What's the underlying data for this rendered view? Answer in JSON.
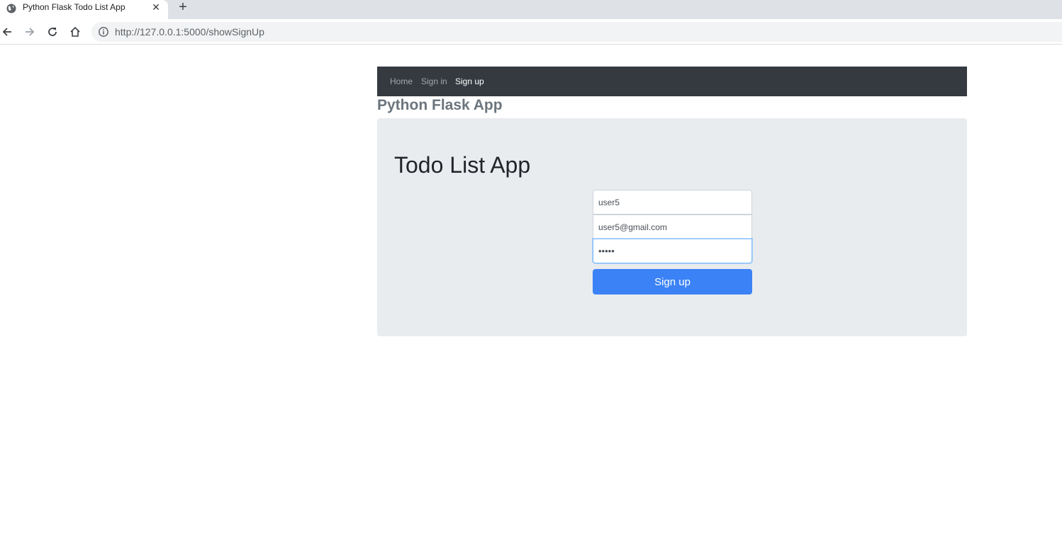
{
  "browser": {
    "tab_title": "Python Flask Todo List App",
    "close_symbol": "✕",
    "new_tab_symbol": "+",
    "url": "http://127.0.0.1:5000/showSignUp"
  },
  "navbar": {
    "links": [
      {
        "label": "Home",
        "active": false
      },
      {
        "label": "Sign in",
        "active": false
      },
      {
        "label": "Sign up",
        "active": true
      }
    ]
  },
  "brand": "Python Flask App",
  "jumbotron": {
    "title": "Todo List App"
  },
  "form": {
    "username_value": "user5",
    "email_value": "user5@gmail.com",
    "password_value": "•••••",
    "submit_label": "Sign up"
  },
  "colors": {
    "navbar_bg": "#343a40",
    "jumbotron_bg": "#e9ecef",
    "primary_button": "#3b82f6"
  }
}
